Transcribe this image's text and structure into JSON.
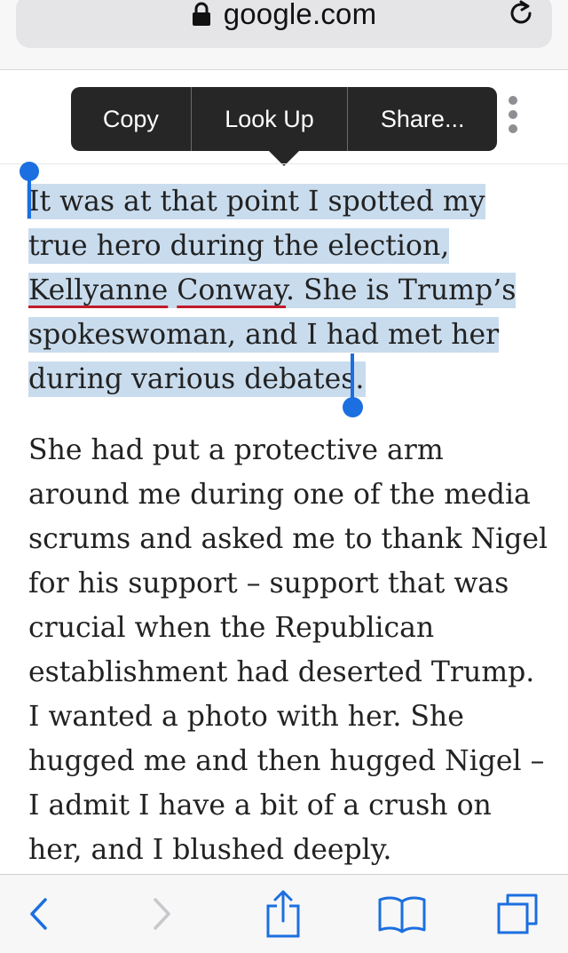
{
  "browser": {
    "url": "google.com",
    "icons": {
      "lock": "lock-icon",
      "reload": "reload-icon"
    }
  },
  "edit_menu": {
    "items": [
      "Copy",
      "Look Up",
      "Share..."
    ],
    "more": "more-icon"
  },
  "article": {
    "paragraph1": {
      "pre": "It was at that point I spotted my true hero during the election, ",
      "name_first": "Kellyanne",
      "space": " ",
      "name_last": "Conway",
      "post": ". She is Trump’s spokeswoman, and I had met her during various debates."
    },
    "paragraph2": "She had put a protective arm around me during one of the media scrums and asked me to thank Nigel for his support – support that was crucial when the Republican establishment had deserted Trump. I wanted a photo with her. She hugged me and then hugged Nigel – I admit I have a bit of a crush on her, and I blushed deeply."
  },
  "toolbar": {
    "icons": [
      "back-icon",
      "forward-icon",
      "share-icon",
      "bookmarks-icon",
      "tabs-icon"
    ]
  },
  "colors": {
    "accent": "#1b6fe0",
    "selection": "#c9dcee",
    "spellcheck": "#c01b2b",
    "menu_bg": "#262626"
  }
}
